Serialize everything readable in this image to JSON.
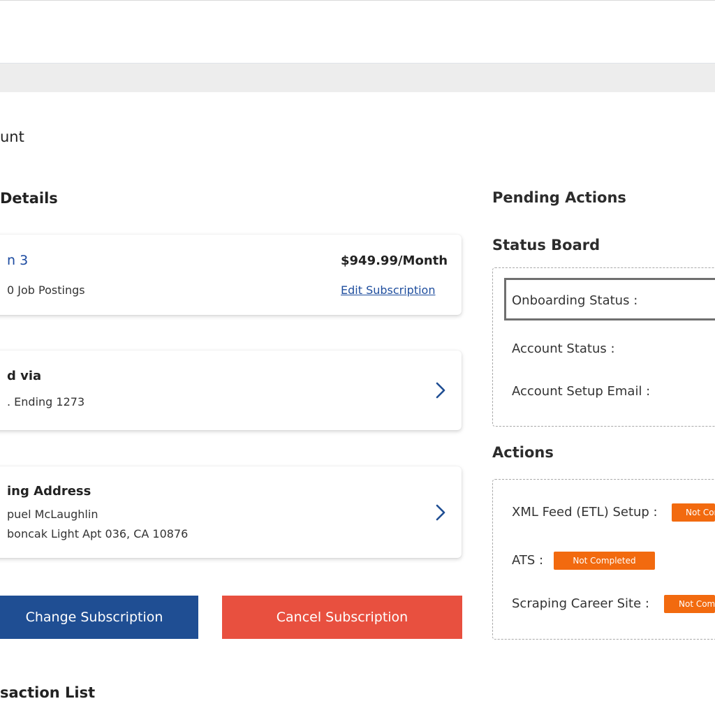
{
  "page": {
    "title": "unt"
  },
  "details": {
    "title": "Details",
    "plan": {
      "name": "n 3",
      "sub": "0 Job Postings",
      "price": "$949.99/Month",
      "edit_label": "Edit Subscription"
    },
    "payment": {
      "title": "d via",
      "sub": ". Ending 1273"
    },
    "address": {
      "title": "ing Address",
      "line1": "puel McLaughlin",
      "line2": "boncak Light Apt 036, CA 10876"
    },
    "buttons": {
      "change": "Change Subscription",
      "cancel": "Cancel Subscription"
    }
  },
  "transactions": {
    "title": "saction List"
  },
  "side": {
    "pending_title": "Pending Actions",
    "status_board": {
      "title": "Status Board",
      "rows": [
        "Onboarding Status :",
        "Account Status :",
        "Account Setup Email :"
      ]
    },
    "actions": {
      "title": "Actions",
      "rows": [
        {
          "label": "XML Feed (ETL) Setup :",
          "badge": "Not Completed"
        },
        {
          "label": "ATS :",
          "badge": "Not Completed"
        },
        {
          "label": "Scraping Career Site :",
          "badge": "Not Completed"
        }
      ]
    }
  },
  "icons": {
    "chevron": "chevron-right-icon"
  },
  "colors": {
    "primary": "#1f4e93",
    "danger": "#e8503f",
    "badge": "#f26a0f",
    "link": "#1f4e9e"
  }
}
